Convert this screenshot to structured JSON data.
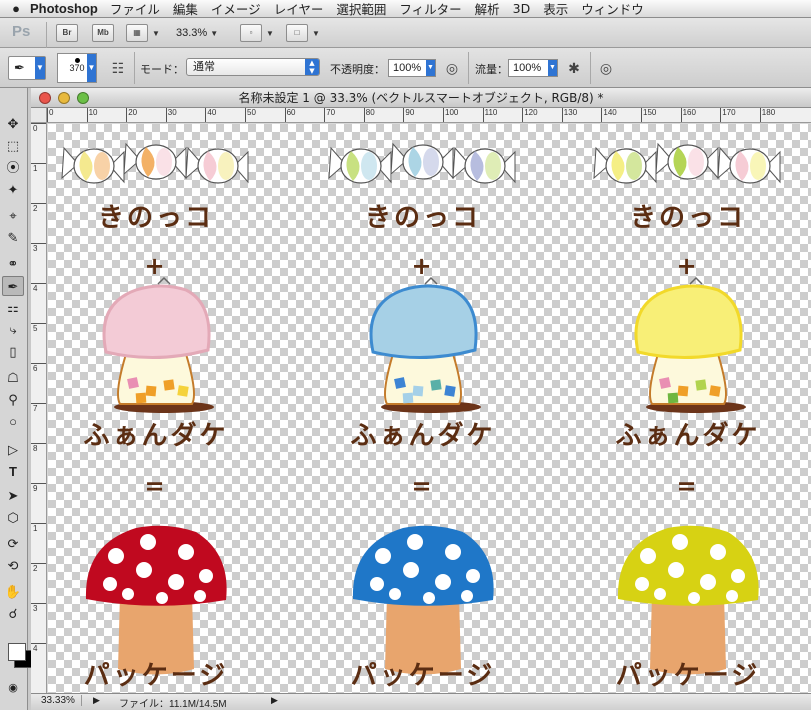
{
  "menubar": {
    "app_name": "Photoshop",
    "items": [
      "ファイル",
      "編集",
      "イメージ",
      "レイヤー",
      "選択範囲",
      "フィルター",
      "解析",
      "3D",
      "表示",
      "ウィンドウ"
    ]
  },
  "app_bar": {
    "logo": "Ps",
    "bridge": "Br",
    "minibridge": "Mb",
    "zoom": "33.3%"
  },
  "options_bar": {
    "brush_size": "370",
    "mode_label": "モード：",
    "mode_value": "通常",
    "opacity_label": "不透明度：",
    "opacity_value": "100%",
    "flow_label": "流量：",
    "flow_value": "100%"
  },
  "document": {
    "title": "名称未設定 1 @ 33.3% (ベクトルスマートオブジェクト, RGB/8) *",
    "ruler_h": [
      "0",
      "10",
      "20",
      "30",
      "40",
      "50",
      "60",
      "70",
      "80",
      "90",
      "100",
      "110",
      "120",
      "130",
      "140",
      "150",
      "160",
      "170",
      "180"
    ],
    "ruler_v": [
      "0",
      "1",
      "2",
      "3",
      "4",
      "5",
      "6",
      "7",
      "8",
      "9",
      "1",
      "2",
      "3",
      "4"
    ],
    "status_zoom": "33.33%",
    "status_file": "ファイル：11.1M/14.5M"
  },
  "artwork": {
    "line1": "きのっコ",
    "plus": "+",
    "line2": "ふぁんダケ",
    "equals": "=",
    "line3": "パッケージ",
    "columns": [
      {
        "candy_colors": [
          "#f3e889",
          "#f2ad5e",
          "#f6c9d3"
        ],
        "cap_color": "#f3cbd6",
        "cap_outline": "#e3a9b7",
        "cookie_color": "#c0091f",
        "squares": [
          "#e98fb3",
          "#ef9f28",
          "#ef9f28",
          "#f5d23b",
          "#ef9f28"
        ]
      },
      {
        "candy_colors": [
          "#c5df7a",
          "#a8d3e4",
          "#b3b9dd"
        ],
        "cap_color": "#a6d0e6",
        "cap_outline": "#3d8bd0",
        "cookie_color": "#1f77c8",
        "squares": [
          "#3d84d4",
          "#a5d0e8",
          "#5ab0a8",
          "#3d84d4",
          "#a5d0e8"
        ]
      },
      {
        "candy_colors": [
          "#f4ee7e",
          "#b1d34d",
          "#f6c9d3"
        ],
        "cap_color": "#f8ef77",
        "cap_outline": "#f2d92a",
        "cookie_color": "#d7d213",
        "squares": [
          "#e98fb3",
          "#ef9f28",
          "#b1d34d",
          "#ef9f28",
          "#6fb640"
        ]
      }
    ]
  }
}
